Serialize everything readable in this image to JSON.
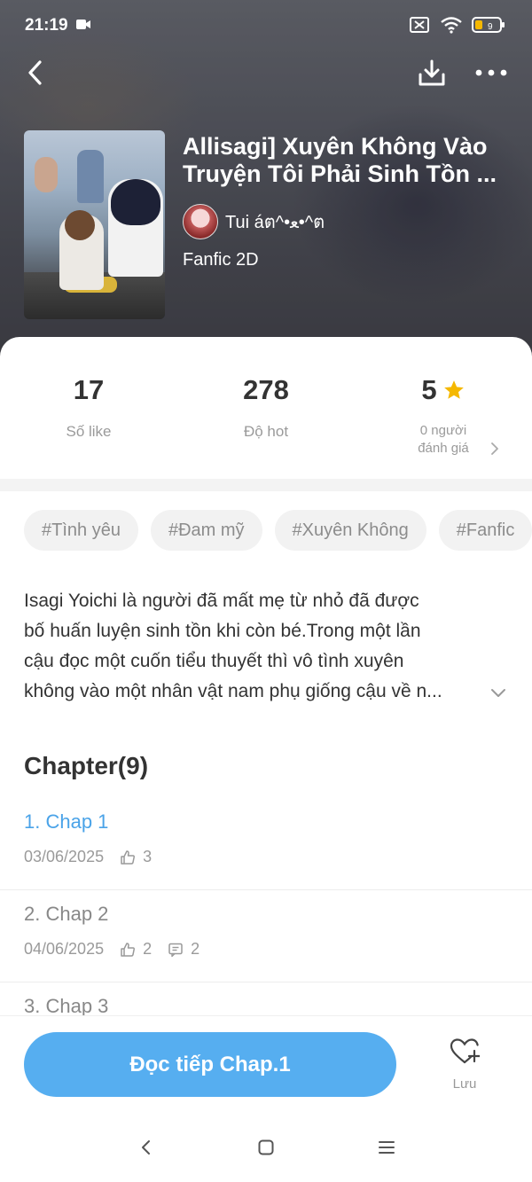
{
  "status_bar": {
    "time": "21:19",
    "icons": [
      "camera-icon",
      "sim-off-icon",
      "wifi-icon",
      "battery-icon"
    ],
    "battery_level": "9"
  },
  "header": {
    "icons": [
      "back-icon",
      "download-icon",
      "more-icon"
    ]
  },
  "story": {
    "title": "Allisagi] Xuyên Không Vào Truyện Tôi Phải Sinh Tồn ...",
    "author": "Tui áต^•ﻌ•^ต",
    "genre": "Fanfic 2D"
  },
  "stats": {
    "likes_value": "17",
    "likes_label": "Số like",
    "hot_value": "278",
    "hot_label": "Độ hot",
    "rating_value": "5",
    "rating_label_1": "0 người",
    "rating_label_2": "đánh giá"
  },
  "tags": [
    "#Tình yêu",
    "#Đam mỹ",
    "#Xuyên Không",
    "#Fanfic"
  ],
  "description": {
    "line1": "Isagi Yoichi là người đã mất mẹ từ nhỏ đã được",
    "line2": "bố huấn luyện sinh tồn khi còn bé.Trong một lần",
    "line3": "cậu đọc một cuốn tiểu thuyết thì vô tình xuyên",
    "line4": "không vào một nhân vật nam phụ giống cậu về n..."
  },
  "chapters": {
    "heading": "Chapter(9)",
    "items": [
      {
        "title": "1. Chap 1",
        "date": "03/06/2025",
        "likes": "3",
        "comments": ""
      },
      {
        "title": "2. Chap 2",
        "date": "04/06/2025",
        "likes": "2",
        "comments": "2"
      },
      {
        "title": "3. Chap 3",
        "date": "",
        "likes": "",
        "comments": ""
      }
    ]
  },
  "bottom": {
    "read_button": "Đọc tiếp Chap.1",
    "save_label": "Lưu"
  },
  "colors": {
    "accent": "#56aef0",
    "active_chapter": "#4aa3e8",
    "star": "#f5b800"
  }
}
